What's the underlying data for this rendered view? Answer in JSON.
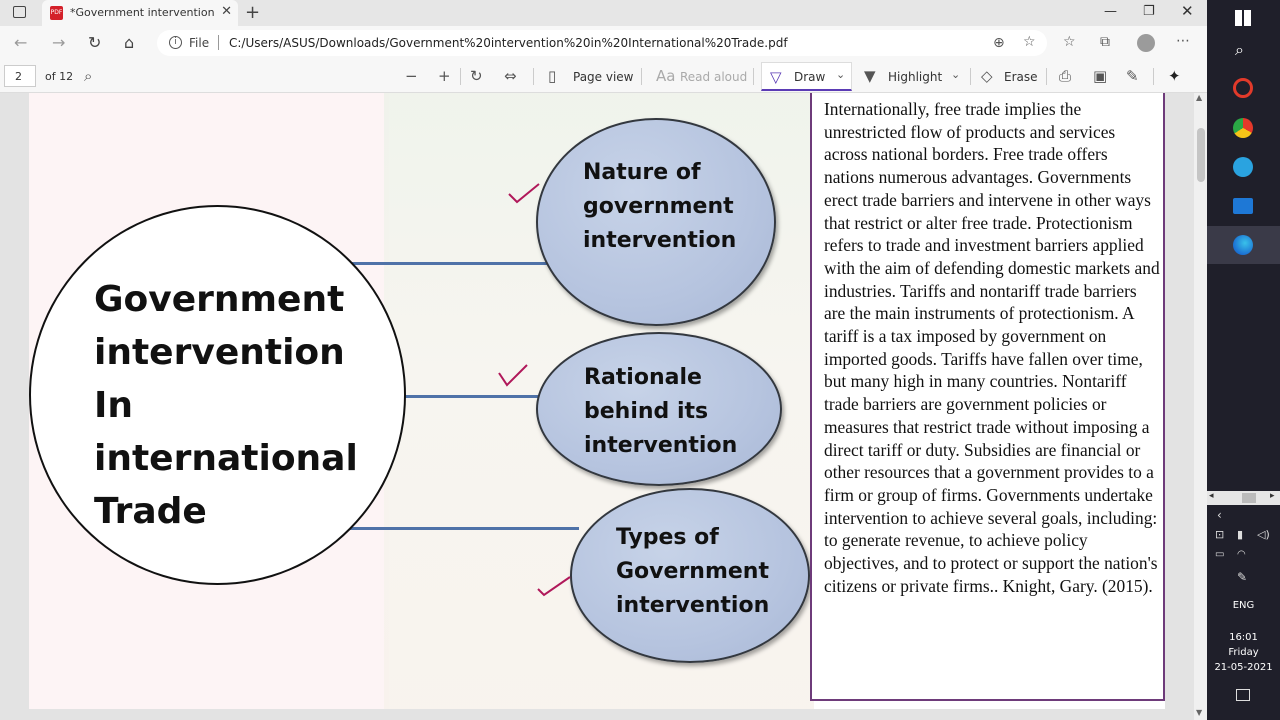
{
  "tab": {
    "title": "*Government intervention in International Trade.pdf"
  },
  "address": {
    "scheme_label": "File",
    "url": "C:/Users/ASUS/Downloads/Government%20intervention%20in%20International%20Trade.pdf"
  },
  "pdf_toolbar": {
    "page_number": "2",
    "page_total": "of 12",
    "page_view": "Page view",
    "read_aloud": "Read aloud",
    "draw": "Draw",
    "highlight": "Highlight",
    "erase": "Erase"
  },
  "slide": {
    "main_title_lines": [
      "Government",
      "intervention",
      "In",
      "international",
      "Trade"
    ],
    "ovals": [
      {
        "lines": [
          "Nature of",
          "government",
          "intervention"
        ]
      },
      {
        "lines": [
          "Rationale",
          "behind its",
          "intervention"
        ]
      },
      {
        "lines": [
          "Types of",
          "Government",
          "intervention"
        ]
      }
    ],
    "side_text": "Internationally, free trade implies the unrestricted flow of products and services across national borders. Free trade offers nations numerous advantages. Governments erect trade barriers and intervene in other ways that restrict or alter free trade. Protectionism refers to trade and investment barriers applied with the aim of defending domestic markets and industries. Tariffs and nontariff trade barriers are the main instruments of protectionism. A tariff is a tax imposed by government on imported goods. Tariffs have fallen over time, but many high in many countries. Nontariff trade barriers are government policies or measures that restrict trade without imposing a direct tariff or duty. Subsidies are financial or other resources that a government provides to a firm or group of firms. Governments undertake intervention to achieve several goals, including: to generate revenue, to achieve policy objectives, and to protect or support the nation's citizens or private firms.. Knight, Gary. (2015)."
  },
  "taskbar": {
    "language": "ENG",
    "time": "16:01",
    "day": "Friday",
    "date": "21-05-2021"
  },
  "colors": {
    "accent": "#5b3bb5",
    "check": "#b0185a",
    "oval": "#b6c4df",
    "taskbar": "#1f1f2a"
  }
}
